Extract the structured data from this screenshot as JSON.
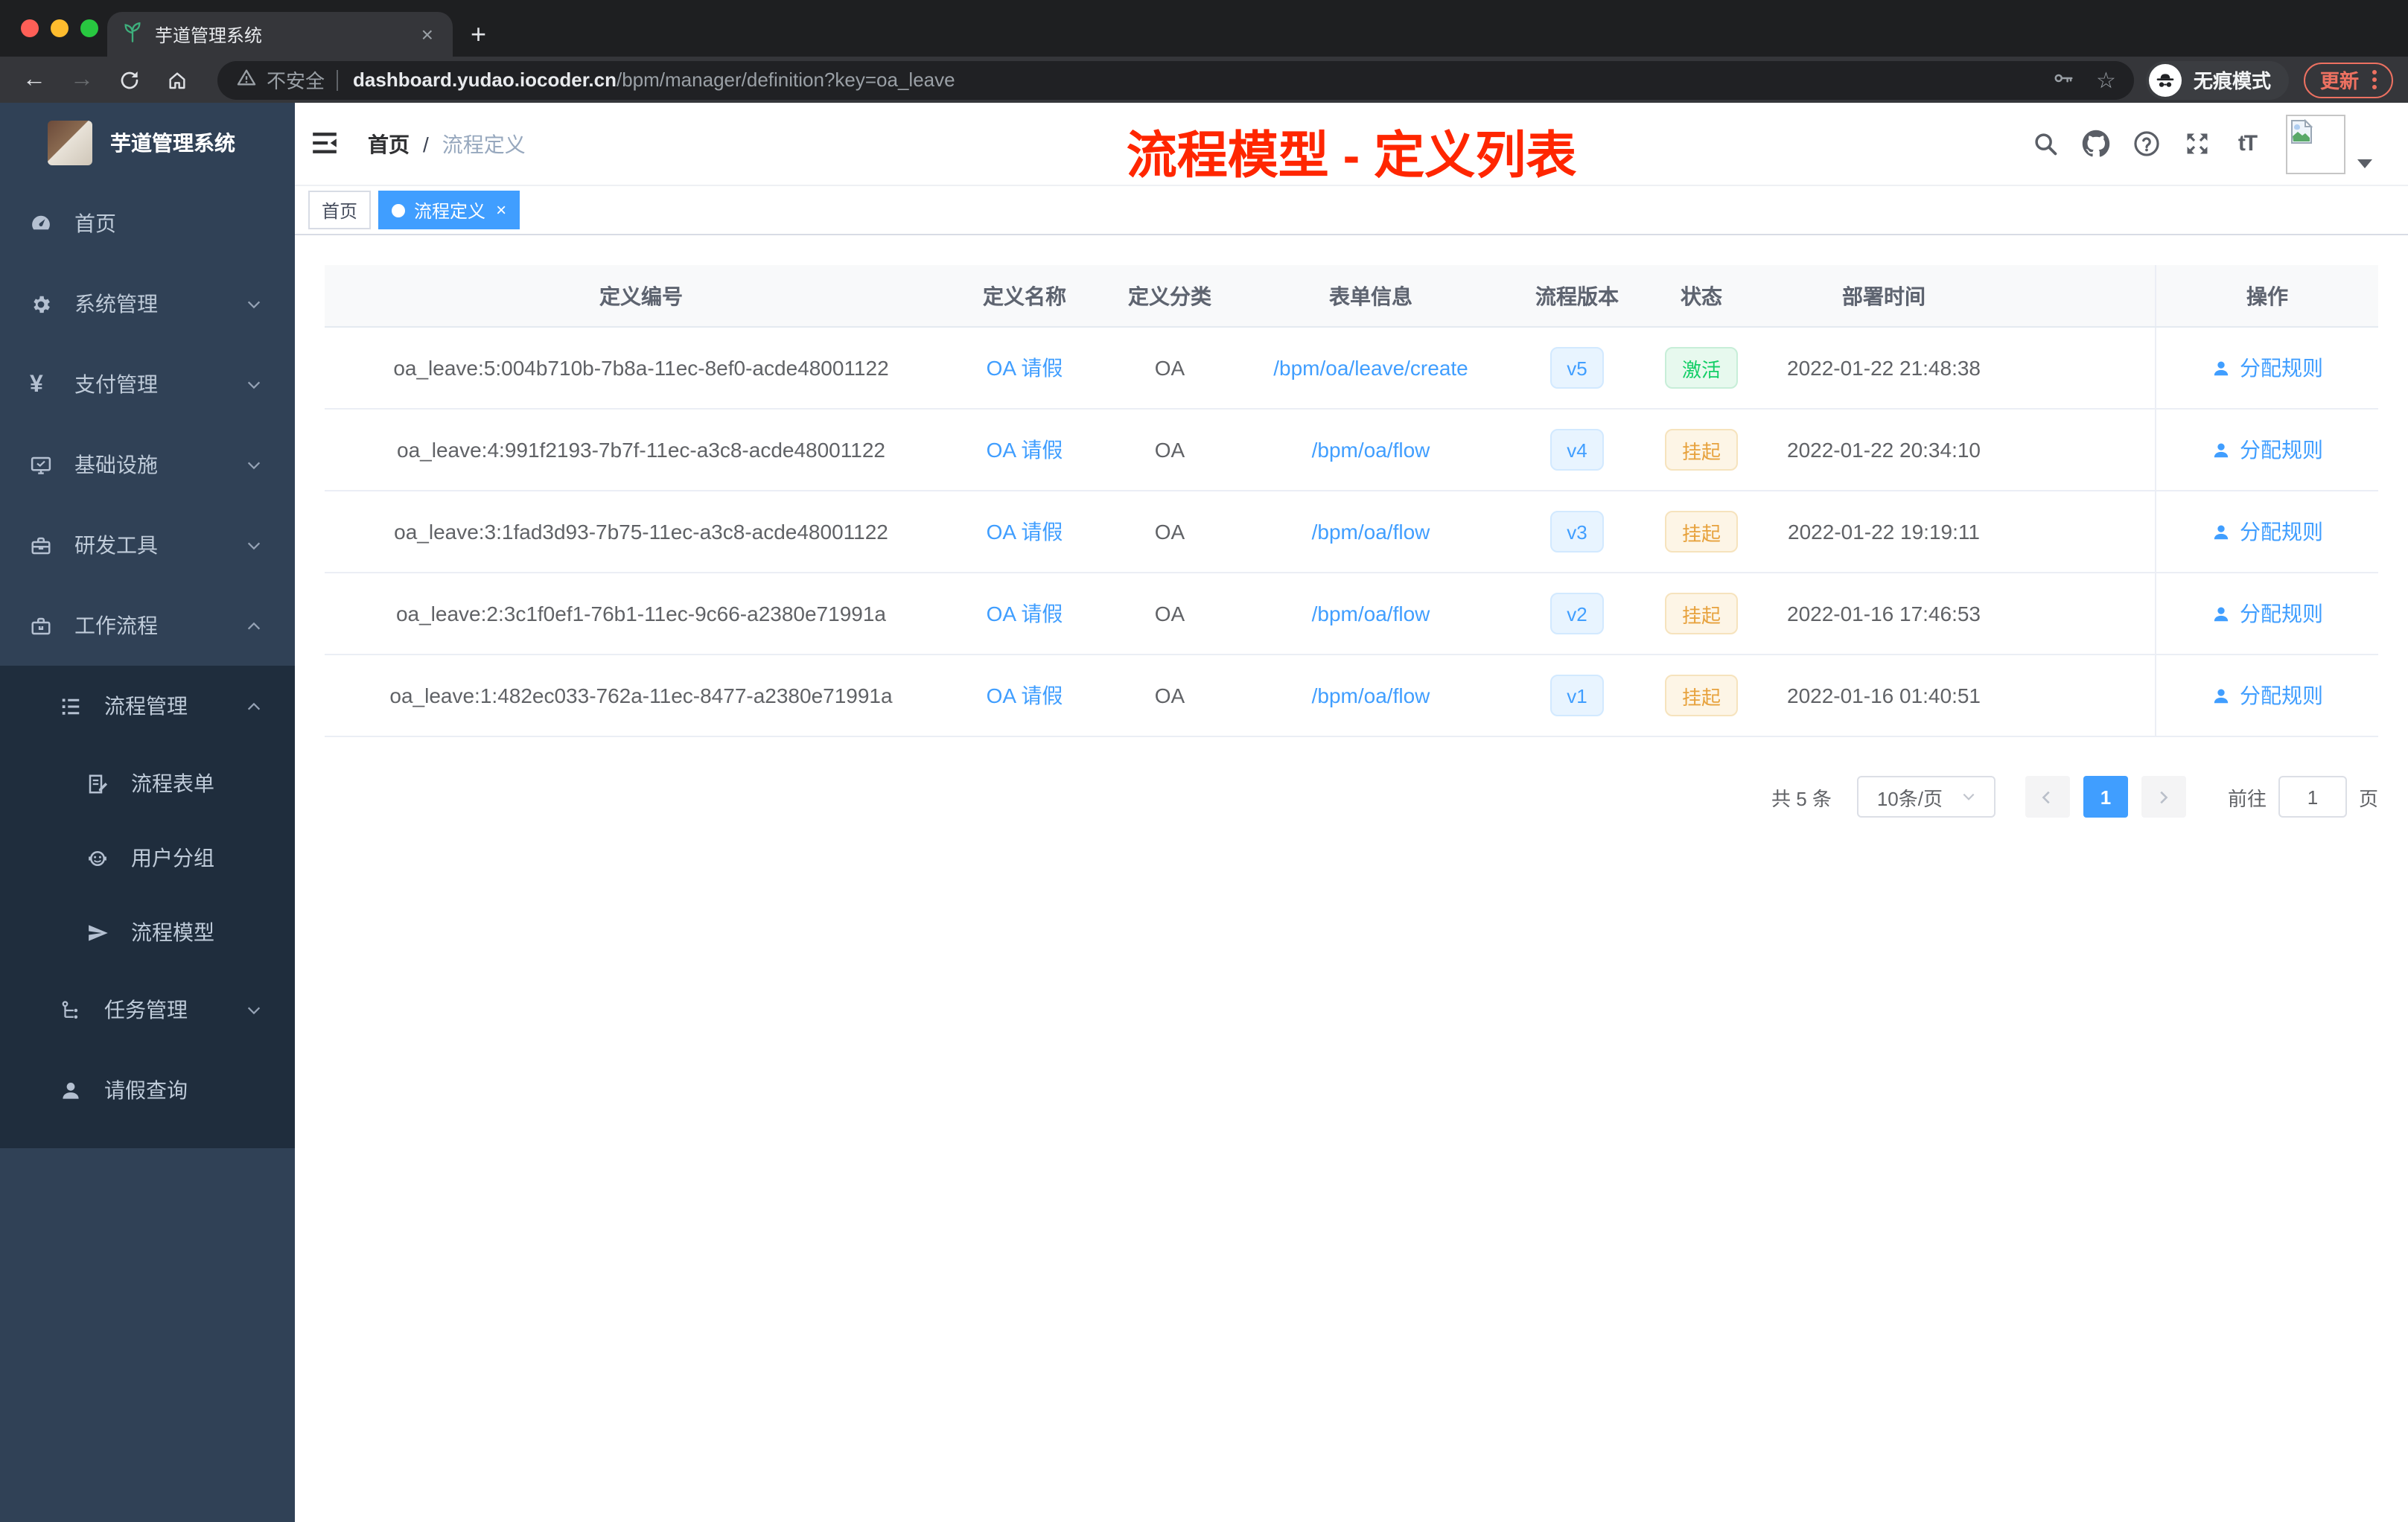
{
  "browser": {
    "tab_title": "芋道管理系统",
    "tab_close_glyph": "×",
    "new_tab_glyph": "+",
    "back_glyph": "←",
    "forward_glyph": "→",
    "security_label": "不安全",
    "url_domain": "dashboard.yudao.iocoder.cn",
    "url_path": "/bpm/manager/definition?key=oa_leave",
    "star_glyph": "☆",
    "incognito_label": "无痕模式",
    "update_label": "更新"
  },
  "header": {
    "breadcrumb_home": "首页",
    "breadcrumb_separator": "/",
    "breadcrumb_current": "流程定义",
    "annotation": "流程模型 - 定义列表",
    "font_size_icon_label": "tT"
  },
  "tags": {
    "items": [
      {
        "label": "首页",
        "active": false
      },
      {
        "label": "流程定义",
        "active": true
      }
    ],
    "close_glyph": "×"
  },
  "sidebar": {
    "title": "芋道管理系统",
    "items": [
      {
        "label": "首页",
        "icon": "dashboard-icon"
      },
      {
        "label": "系统管理",
        "icon": "gear-icon"
      },
      {
        "label": "支付管理",
        "icon": "yen-icon",
        "icon_glyph": "¥"
      },
      {
        "label": "基础设施",
        "icon": "monitor-icon"
      },
      {
        "label": "研发工具",
        "icon": "toolbox-icon"
      },
      {
        "label": "工作流程",
        "icon": "briefcase-icon"
      }
    ],
    "workflow_submenu": {
      "group": {
        "label": "流程管理",
        "icon": "list-tree-icon"
      },
      "children": [
        {
          "label": "流程表单",
          "icon": "form-icon"
        },
        {
          "label": "用户分组",
          "icon": "robot-icon"
        },
        {
          "label": "流程模型",
          "icon": "paper-plane-icon"
        }
      ],
      "siblings": [
        {
          "label": "任务管理",
          "icon": "org-tree-icon"
        },
        {
          "label": "请假查询",
          "icon": "user-icon"
        }
      ]
    }
  },
  "table": {
    "columns": [
      "定义编号",
      "定义名称",
      "定义分类",
      "表单信息",
      "流程版本",
      "状态",
      "部署时间",
      "操作"
    ],
    "rows": [
      {
        "id": "oa_leave:5:004b710b-7b8a-11ec-8ef0-acde48001122",
        "name": "OA 请假",
        "category": "OA",
        "form": "/bpm/oa/leave/create",
        "version": "v5",
        "status": "激活",
        "status_type": "success",
        "time": "2022-01-22 21:48:38",
        "action": "分配规则"
      },
      {
        "id": "oa_leave:4:991f2193-7b7f-11ec-a3c8-acde48001122",
        "name": "OA 请假",
        "category": "OA",
        "form": "/bpm/oa/flow",
        "version": "v4",
        "status": "挂起",
        "status_type": "warning",
        "time": "2022-01-22 20:34:10",
        "action": "分配规则"
      },
      {
        "id": "oa_leave:3:1fad3d93-7b75-11ec-a3c8-acde48001122",
        "name": "OA 请假",
        "category": "OA",
        "form": "/bpm/oa/flow",
        "version": "v3",
        "status": "挂起",
        "status_type": "warning",
        "time": "2022-01-22 19:19:11",
        "action": "分配规则"
      },
      {
        "id": "oa_leave:2:3c1f0ef1-76b1-11ec-9c66-a2380e71991a",
        "name": "OA 请假",
        "category": "OA",
        "form": "/bpm/oa/flow",
        "version": "v2",
        "status": "挂起",
        "status_type": "warning",
        "time": "2022-01-16 17:46:53",
        "action": "分配规则"
      },
      {
        "id": "oa_leave:1:482ec033-762a-11ec-8477-a2380e71991a",
        "name": "OA 请假",
        "category": "OA",
        "form": "/bpm/oa/flow",
        "version": "v1",
        "status": "挂起",
        "status_type": "warning",
        "time": "2022-01-16 01:40:51",
        "action": "分配规则"
      }
    ]
  },
  "pagination": {
    "total_label": "共 5 条",
    "page_size_label": "10条/页",
    "current_page": "1",
    "goto_label": "前往",
    "goto_value": "1",
    "page_unit_label": "页"
  },
  "colors": {
    "accent_blue": "#409eff",
    "success_green": "#13ce66",
    "warning_orange": "#e6a23c",
    "annotation_red": "#ff2600",
    "sidebar_bg": "#304156",
    "sidebar_submenu_bg": "#1f2d3d",
    "sidebar_text": "#bfcbd9",
    "browser_frame": "#1e1f21",
    "browser_toolbar": "#35363a",
    "update_button": "#ed7161"
  }
}
